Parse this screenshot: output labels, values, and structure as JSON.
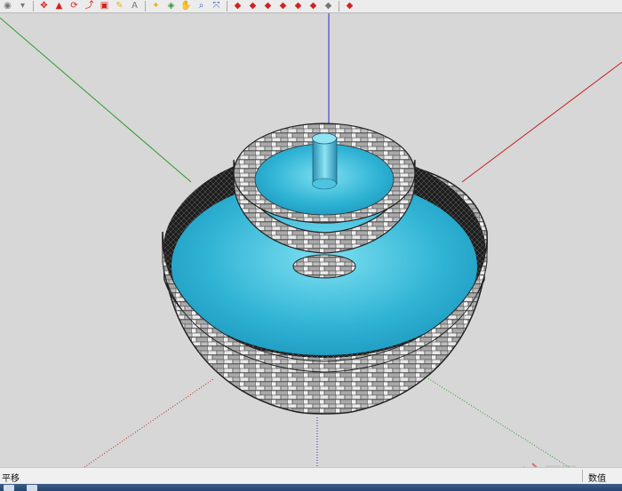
{
  "toolbar": {
    "colors": {
      "red": "#d42020",
      "blue": "#2e5fbf",
      "yellow": "#e3b514",
      "green": "#2e9a2e",
      "gray": "#777777"
    },
    "buttons": [
      {
        "name": "orbit-icon",
        "glyph": "◉",
        "color": "gray"
      },
      {
        "name": "dropdown-arrow-icon",
        "glyph": "▾",
        "color": "gray"
      },
      {
        "name": "move-icon",
        "glyph": "✥",
        "color": "red"
      },
      {
        "name": "push-pull-icon",
        "glyph": "▲",
        "color": "red"
      },
      {
        "name": "rotate-icon",
        "glyph": "⟳",
        "color": "red"
      },
      {
        "name": "follow-me-icon",
        "glyph": "⤴",
        "color": "red"
      },
      {
        "name": "offset-icon",
        "glyph": "▣",
        "color": "red"
      },
      {
        "name": "tape-measure-icon",
        "glyph": "✎",
        "color": "yellow"
      },
      {
        "name": "text-icon",
        "glyph": "A",
        "color": "gray"
      },
      {
        "name": "paint-bucket-icon",
        "glyph": "✦",
        "color": "yellow"
      },
      {
        "name": "orbit-view-icon",
        "glyph": "◈",
        "color": "green"
      },
      {
        "name": "pan-icon",
        "glyph": "✋",
        "color": "yellow"
      },
      {
        "name": "zoom-icon",
        "glyph": "⌕",
        "color": "blue"
      },
      {
        "name": "zoom-extents-icon",
        "glyph": "⤧",
        "color": "blue"
      },
      {
        "name": "previous-view-icon",
        "glyph": "◆",
        "color": "red"
      },
      {
        "name": "next-view-icon",
        "glyph": "◆",
        "color": "red"
      },
      {
        "name": "components-icon",
        "glyph": "◆",
        "color": "red"
      },
      {
        "name": "warehouse-icon",
        "glyph": "◆",
        "color": "red"
      },
      {
        "name": "share-model-icon",
        "glyph": "◆",
        "color": "red"
      },
      {
        "name": "extension-icon",
        "glyph": "◆",
        "color": "red"
      },
      {
        "name": "photo-texture-icon",
        "glyph": "◆",
        "color": "gray"
      },
      {
        "name": "plugin-icon",
        "glyph": "◆",
        "color": "red"
      }
    ]
  },
  "colors": {
    "background": "#d7d7d7",
    "axis_red": "#c61e1e",
    "axis_green": "#2a9a2a",
    "axis_blue": "#2b2bd0",
    "water": "#2fb3d4",
    "water_light": "#7ee0f2",
    "stone_light": "#e6e6e6",
    "stone_dark": "#5a5a5a",
    "edge": "#2a2a2a"
  },
  "status": {
    "left_text": "平移",
    "value_label": "数值"
  }
}
